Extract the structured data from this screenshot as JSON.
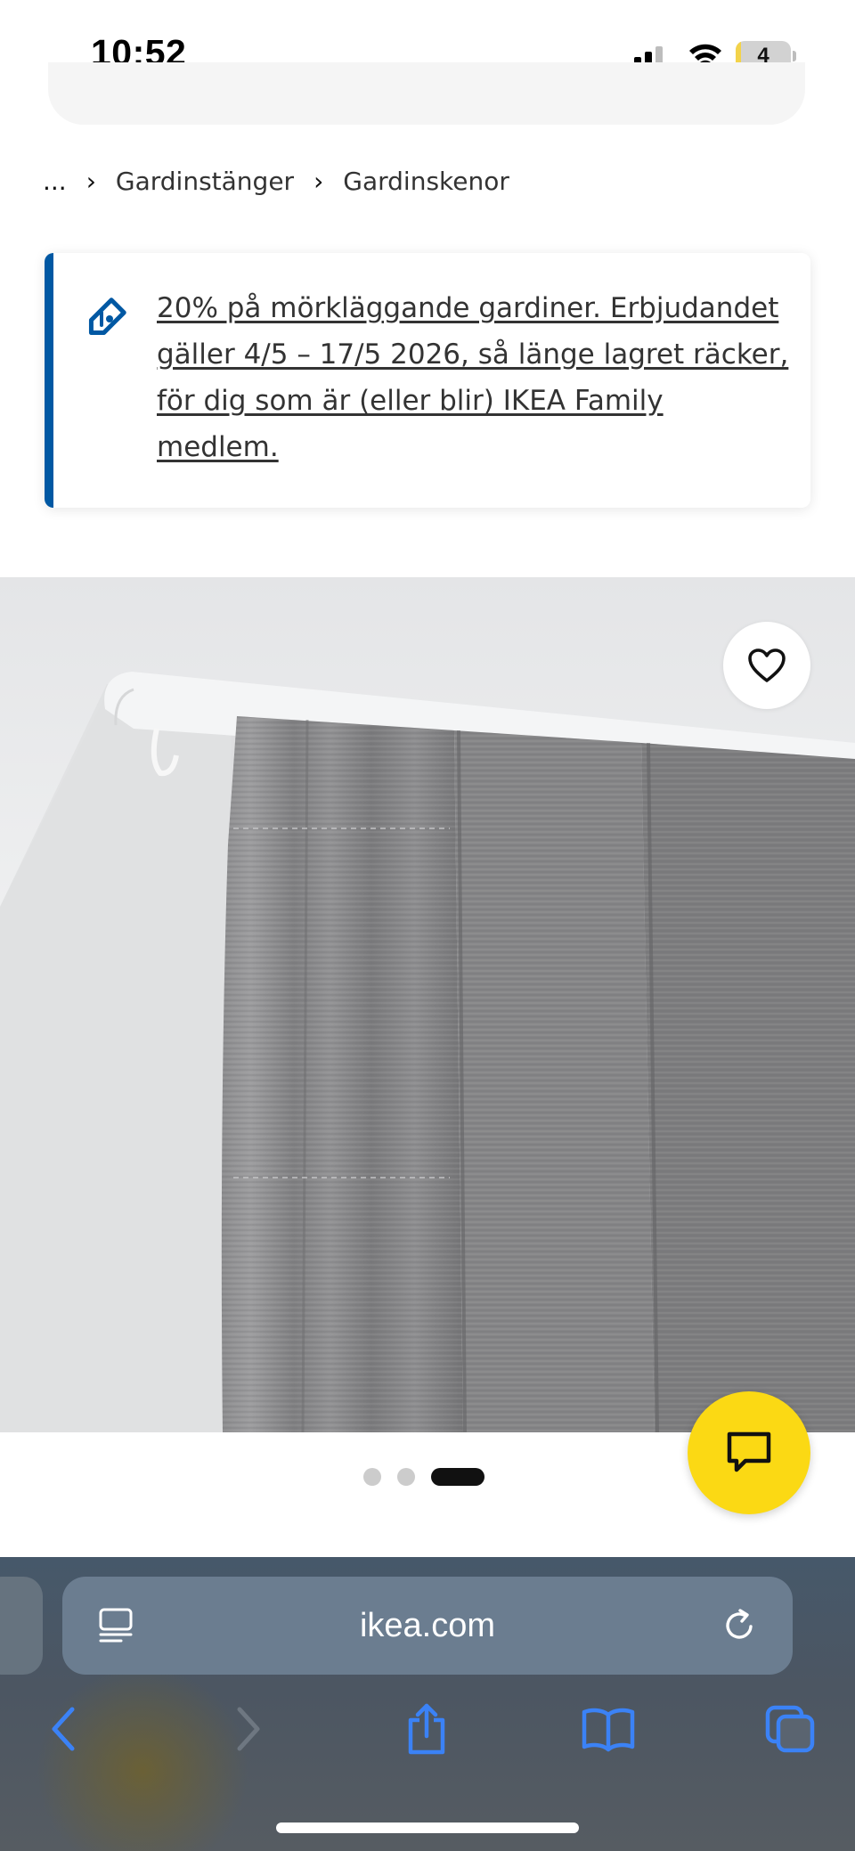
{
  "status_bar": {
    "time": "10:52",
    "battery_level": "4",
    "battery_fraction": 0.1
  },
  "breadcrumb": {
    "ellipsis": "...",
    "items": [
      "Gardinstänger",
      "Gardinskenor"
    ]
  },
  "promo": {
    "text": "20% på mörkläggande gardiner. Erbjudandet gäller 4/5 – 17/5 2026, så länge lagret räcker, för dig som är (eller blir) IKEA Family medlem.",
    "icon": "price-tag-icon",
    "accent_color": "#0058a3"
  },
  "product_gallery": {
    "image_count": 3,
    "active_index": 2,
    "favourite_icon": "heart-icon"
  },
  "chat": {
    "icon": "chat-bubble-icon",
    "color": "#fbd914"
  },
  "browser": {
    "url": "ikea.com",
    "icons": {
      "reader": "reader-mode-icon",
      "reload": "reload-icon",
      "back": "back-arrow-icon",
      "forward": "forward-arrow-icon",
      "share": "share-icon",
      "bookmarks": "bookmarks-icon",
      "tabs": "tabs-icon"
    },
    "accent_color": "#3b82f6"
  }
}
